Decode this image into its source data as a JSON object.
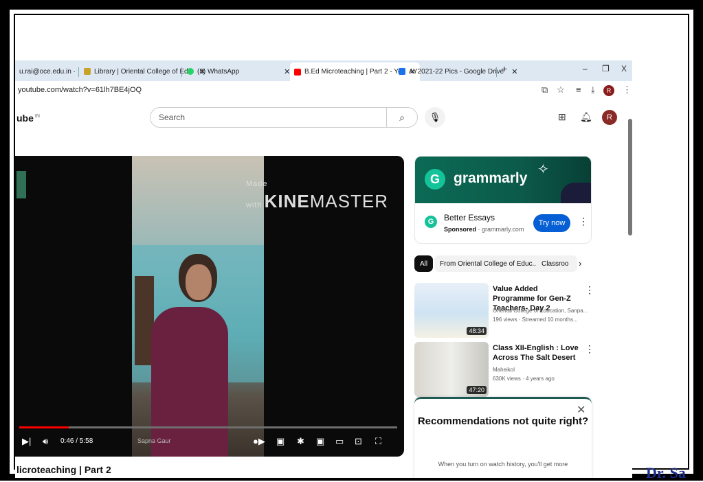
{
  "tabs": [
    {
      "label": "u.rai@oce.edu.in ·",
      "favicon_color": "#e8a33c"
    },
    {
      "label": "Library | Oriental College of Edu",
      "favicon_color": "#c9a227"
    },
    {
      "label": "(8) WhatsApp",
      "favicon_color": "#25d366"
    },
    {
      "label": "B.Ed Microteaching | Part 2 - Yo",
      "favicon_color": "#ff0000"
    },
    {
      "label": "AY2021-22 Pics - Google Drive",
      "favicon_color": "#1a73e8"
    }
  ],
  "window": {
    "minimize": "–",
    "maximize": "❐",
    "close": "X",
    "new_tab": "+"
  },
  "address_bar": {
    "url": "youtube.com/watch?v=61lh7BE4jOQ",
    "profile_initial": "R"
  },
  "youtube": {
    "logo_text": "ube",
    "region": "IN",
    "search_placeholder": "Search",
    "avatar_initial": "R"
  },
  "video": {
    "watermark_prefix": "Made with",
    "watermark_bold": "KINE",
    "watermark_rest": "MASTER",
    "time": "0:46 / 5:58",
    "progress_fraction": 0.13,
    "caption_name": "Sapna Gaur",
    "title": "licroteaching | Part 2"
  },
  "ad": {
    "brand": "grammarly",
    "title": "Better Essays",
    "sponsored": "Sponsored",
    "domain": "· grammarly.com",
    "cta": "Try now"
  },
  "chips": [
    "All",
    "From Oriental College of Educ...",
    "Classroo"
  ],
  "recommended": [
    {
      "title": "Value Added Programme for Gen-Z Teachers- Day 2",
      "channel": "Oriental College of Education, Sanpa...",
      "meta": "196 views · Streamed 10 months...",
      "duration": "48:34"
    },
    {
      "title": "Class XII-English : Love Across The Salt Desert",
      "channel": "Maheikol",
      "meta": "630K views · 4 years ago",
      "duration": "47:20"
    }
  ],
  "rec_card": {
    "title": "Recommendations not quite right?",
    "text": "When you turn on watch history, you'll get more"
  },
  "signature": "Dr. Sa"
}
